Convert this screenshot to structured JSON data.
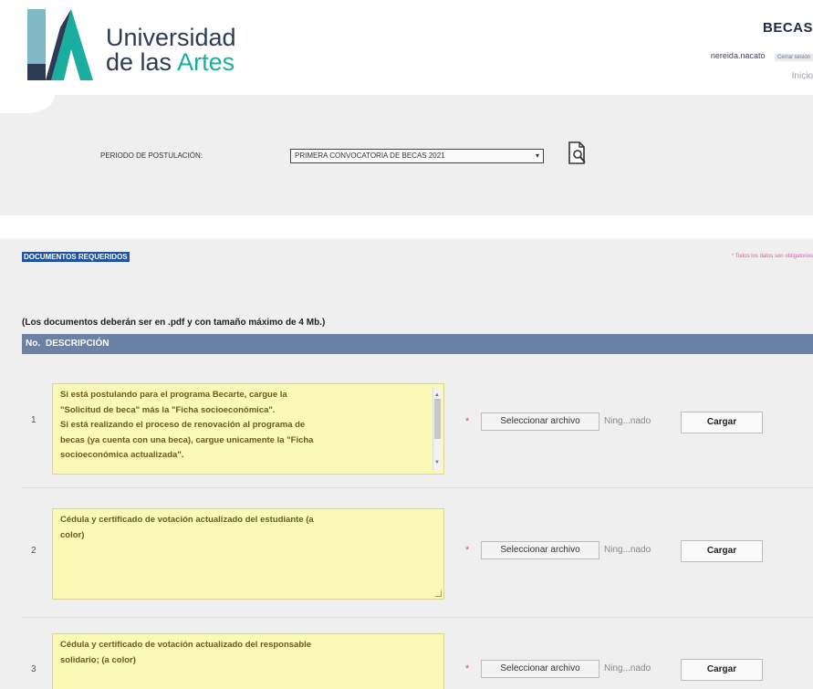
{
  "header": {
    "logo_line1": "Universidad",
    "logo_line2_prefix": "de las ",
    "logo_line2_accent": "Artes",
    "app_title": "BECAS",
    "username": "nereida.nacato",
    "logout_label": "Cerrar sesión",
    "home_link": "Inicio"
  },
  "period": {
    "label": "PERIODO DE POSTULACIÓN:",
    "selected": "PRIMERA CONVOCATORIA DE BECAS 2021",
    "view_icon": "document-search-icon"
  },
  "documents": {
    "title": "DOCUMENTOS REQUERIDOS",
    "required_note": "* Todos los datos son obligatorios",
    "note": "(Los documentos deberán ser en .pdf y con tamaño máximo de 4 Mb.)",
    "col_no": "No.",
    "col_desc": "DESCRIPCIÓN",
    "file_button_label": "Seleccionar archivo",
    "file_status": "Ning...nado",
    "upload_label": "Cargar",
    "asterisk": "*",
    "rows": [
      {
        "no": "1",
        "desc_lines": [
          "Si está postulando para el programa Becarte, cargue la",
          "\"Solicitud de beca\" más la \"Ficha socioeconómica\".",
          "Si está realizando el proceso de renovación al programa de",
          "becas (ya cuenta con una beca), cargue unicamente la \"Ficha",
          "socioeconómica actualizada\"."
        ]
      },
      {
        "no": "2",
        "desc_lines": [
          "Cédula y certificado de votación actualizado del estudiante (a",
          "color)"
        ]
      },
      {
        "no": "3",
        "desc_lines": [
          "Cédula y certificado de votación actualizado del responsable",
          "solidario; (a color)"
        ]
      }
    ]
  }
}
